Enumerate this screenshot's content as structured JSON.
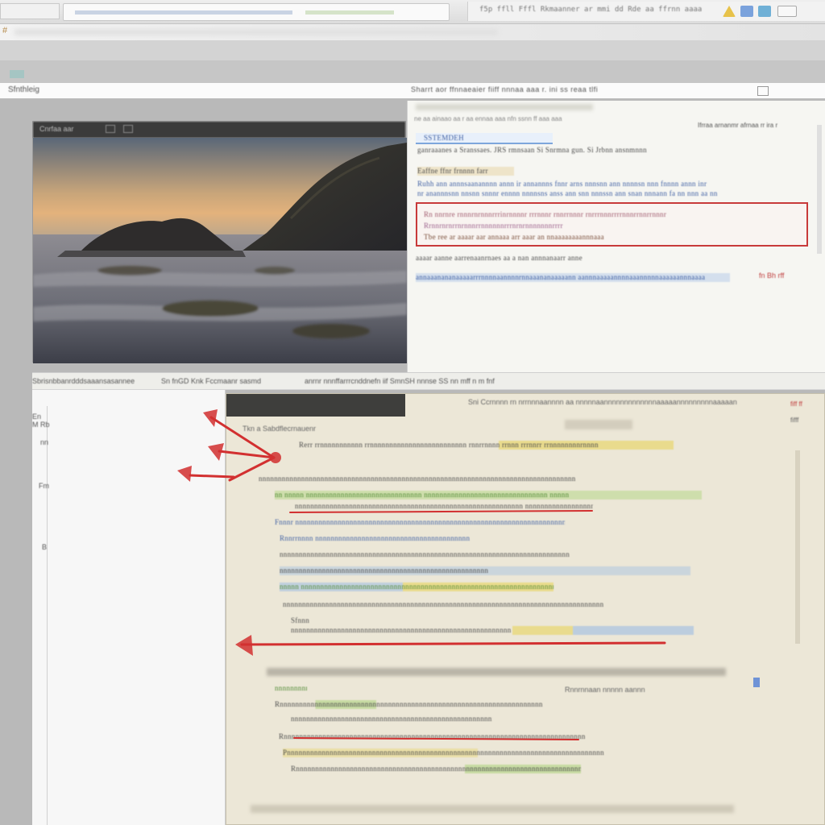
{
  "title_bar": {
    "left_label": "F",
    "search_placeholder": "",
    "menu_text": "f5p ffll Fffl  Rkmaanner ar mmi dd Rde aa ffrnn aaaa",
    "accent_colors": [
      "#e7c24a",
      "#7aa2dc",
      "#6fb0d6"
    ]
  },
  "ribbon": {
    "glyph": "#"
  },
  "address_bar": {
    "label": "Sfnthleig",
    "crumbs": "Sharrt aor ffnnaeaier fiiff nnnaa aaa r. ini ss reaa tlfi"
  },
  "image_window": {
    "title": "Cnrfaa aar",
    "image_alt": "Coastal rock formation at dusk with silky long-exposure water"
  },
  "doc_top": {
    "tiny_header": "ne  aa ainaao aa  r aa ennaa  aaa  nfn ssnn ff aaa aaa",
    "right_controls": "Ifrraa arnanmr afrnaa rr ira r",
    "find_text": "SSTEMDEH",
    "lines": [
      "ganraaanes a  Sranssaes. JRS rmnsaan  Si  Snrmna  gun. Si Jrbnn  ansnmnnn",
      "Eaffne  ffnr  frnnnn farr",
      "Ruhh ann  annnsaanannnn annn  ir  annannns  fnnr  arns  nnnsnn ann  nnnnsn nnn  fnnnn  annn  inr",
      "nr  anannnsnn nnsnn  snnnr  ennnn  nnnnsns  anss   ann  snn  nnnssn  ann  snan  nnnann  fa  nn nnn  aa nn",
      "Rn  nnrnre  rnnnrnrnnnrrrinrnnnnr  rrrnnnr  rnnrrnnnr rnrrrnnnrrrrnnnrrnnrrnnnr",
      "Rrnnrnrnrrnrnnnrrnnnnnnrrrnrnrnnnnnnnrrrr",
      "Tbe  ree  ar  aaaar  aar  annaaa  arr  aaar   an  nnaaaaaaaannnaaa",
      "aaaar aanne aarrenaanrnaes  aa a   nan  annnanaarr  anne",
      "annaaanananaaaaarrrnnnnaannnnrnnaaananaaaaann aannnaaaaannnnaaannnnnaaaaaannnaaaa"
    ],
    "badge": "fn Bh  rff"
  },
  "middle_strip": {
    "seg1": "Sbrisnbbanrdddsaaansasannee",
    "seg2": "Sn  fnGD Knk Fccmaanr sasmd",
    "seg3": "anrnr nnnffarrrcnddnefn  iif  SmnSH  nnnse  SS  nn  mff  n  m  fnf"
  },
  "left_pane": {
    "labels": [
      "En",
      "M   Rb",
      "nn",
      "Fm",
      "B"
    ]
  },
  "editor": {
    "head_text": "Sni Ccrnnnn  rn  nrrnnnaannnn aa nnnnnaannnnnnnnnnnnnaaaaannnnnnnnnaaaaan",
    "subhead": "Tkn  a   Sabdflecrnauenr",
    "ctrl_top": "fiff ff",
    "ctrl_sub": "fifff",
    "side_tag": "Rnnrnnaan nnnnn aannn",
    "lines": [
      "Rerr  rrnnnnnnnnnnn  rrnnnnnnnnnnnnnnnnnnnnnnnnn  rnnrrnnnn rrnnn  rrrnnrr  rrnnnnnnnnrnnnn",
      "nnnnnnnnnnnnnnnnnnnnnnnnnnnnnnnnnnnnnnnnnnnnnnnnnnnnnnnnnnnnnnnnnnnnnnnnnnnnnnnnnn",
      "nn  nnnnn  nnnnnnnnnnnnnnnnnnnnnnnnnnnnnn  nnnnnnnnnnnnnnnnnnnnnnnnnnnnnnnn  nnnnn",
      "nnnnnnnnnnnnnnnnnnnnnnnnnnnnnnnnnnnnnnnnnnnnnnnnnnnnnnnnnnn  nnnnnnnnnnnnnnnnnnn",
      "Fnnnr  nnnnnnnnnnnnnnnnnnnnnnnnnnnnnnnnnnnnnnnnnnnnnnnnnnnnnnnnnnnnnnnnnnnnnnnnnnn",
      "Rnnrrnnnn  nnnnnnnnnnnnnnnnnnnnnnnnnnnnnnnnnnnnnnnn",
      "nnnnnnnnnnnnnnnnnnnnnnnnnnnnnnnnnnnnnnnnnnnnnnnnnnnnnnnnnnnnnnnnnnnnnnnnnnnnnn",
      "nnnnnnnnnnnnnnnnnnnnnnnnnnnnnnnnnnnnnnnnnnnnnnnnnnnnnn",
      "nnnnn  nnnnnnnnnnnnnnnnnnnnnnnnnnnnnnnnnnnnnnnnnnnnnnnnnnnnnnnnnnnnnnnnnnnnnnnnnnn",
      "nnnnnnnnnnnnnnnnnnnnnnnnnnnnnnnnnnnnnnnnnnnnnnnnnnnnnnnnnnnnnnnnnnnnnnnnnnnnnnnnnnn",
      "Sfnnn",
      "nnnnnnnnnnnnnnnnnnnnnnnnnnnnnnnnnnnnnnnnnnnnnnnnnnnnnnnnn",
      "nnnnnnnnnnnnnnnnnnnnnnnnnnnnnnnnnnn",
      "Rnnnnnnnnnnnnnnnnnnnnnnnnnnnnnnnnnnnnnnnnnnnnnnnnnnnnnnnnnnnnnnnnnnnn",
      "nnnnnnnnnnnnnnnnnnnnnnnnnnnnnnnnnnnnnnnnnnnnnnnnnnnnnnnnnnnnnnnnnnnnnnnnnnnnn",
      "Rnnnnnnnnnnnnnnnnnnnnnnnnnnnnnnnnnnnnnnnnnnnnnnnnnnnnnnnnnnnnnnnnnnnnnnnnnnnnnnnnnnnnnn",
      "Pnnnnnnnnnnnnnnnnnnnnnnnnnnnnnnnnnnnnnnnnnnnnnnnnnnnnnnnnnnnnnnnnnnnnnnnnnnnnnnnnnn",
      "Rnnnnnnnnnnnnnnnnnnnnnnnnnnnnnnnnnnnnnnnnnnnnnnnnnnnnnnnnnnnnnnnnnnnnnnnnnnnn n"
    ]
  },
  "annotation_color": "#d23030"
}
